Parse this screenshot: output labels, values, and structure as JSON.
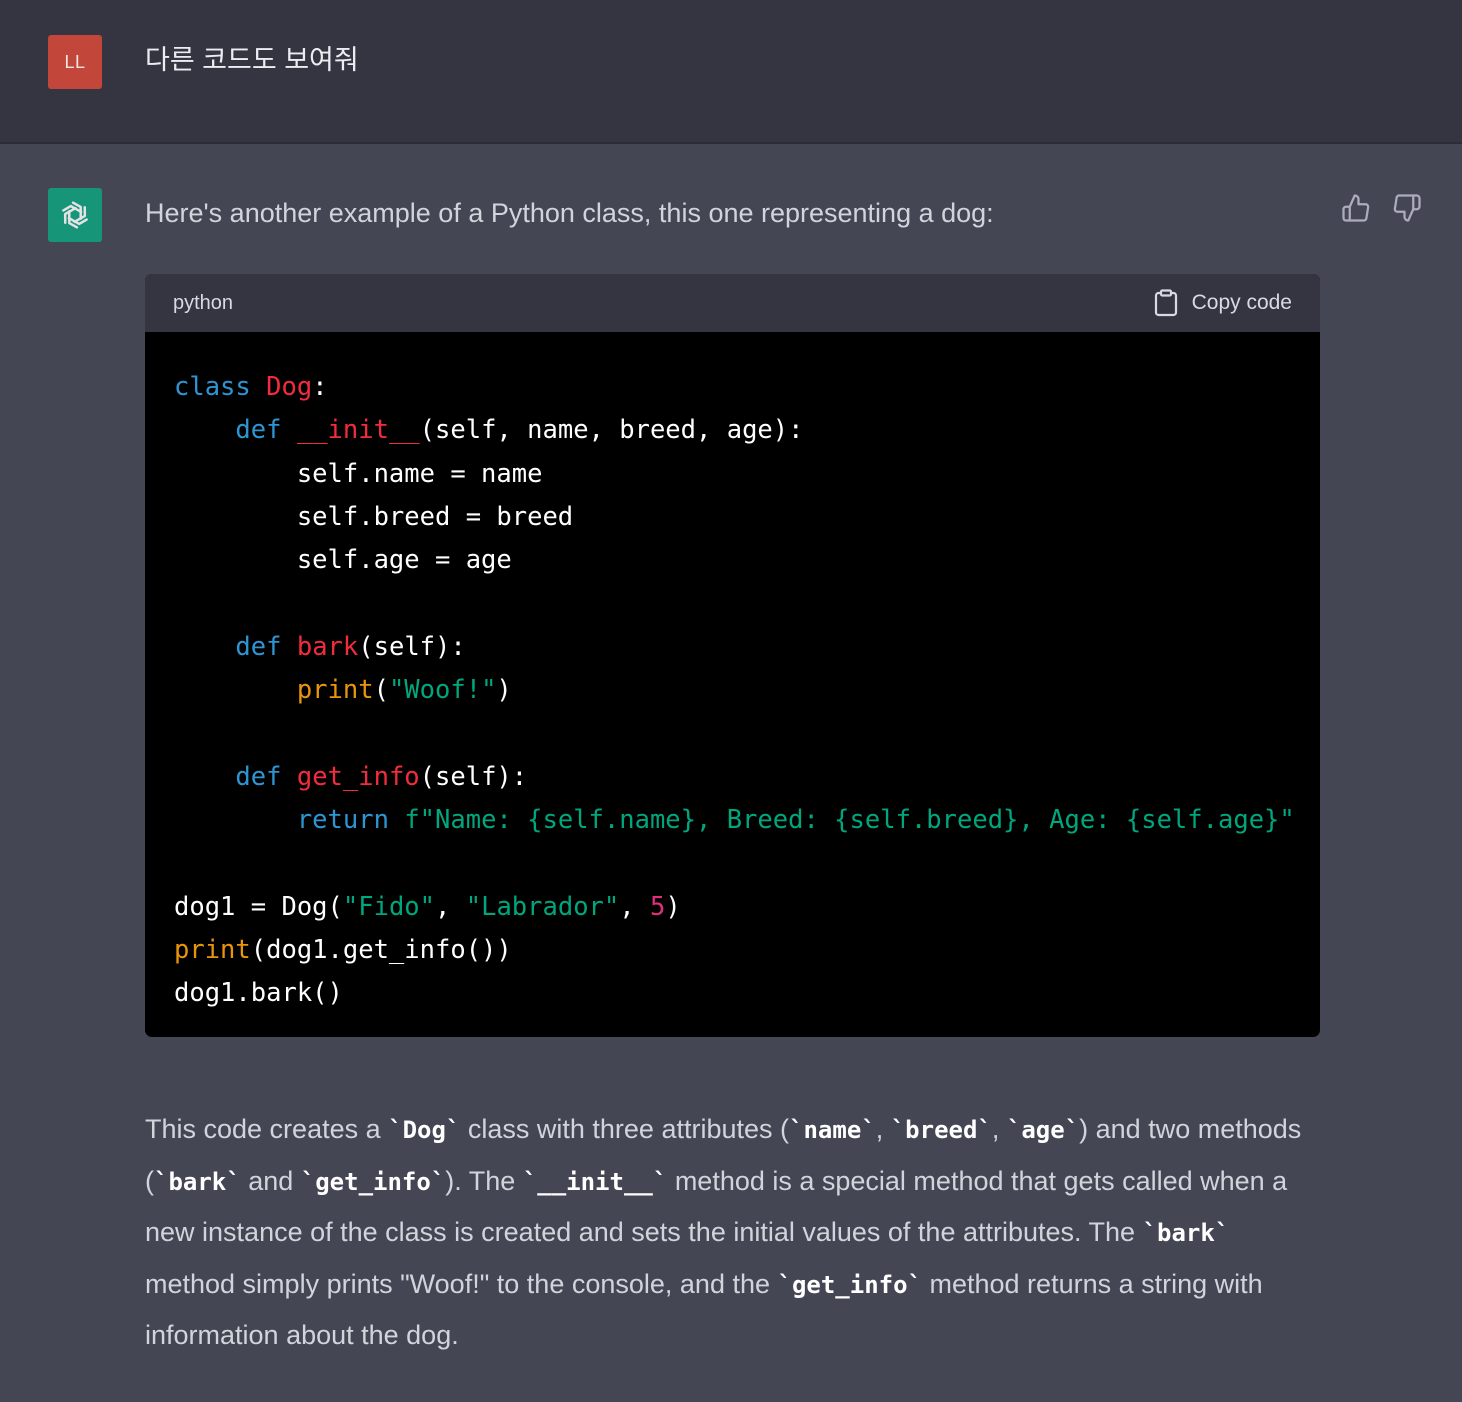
{
  "user": {
    "avatar_initials": "LL",
    "message": "다른 코드도 보여줘"
  },
  "assistant": {
    "intro": "Here's another example of a Python class, this one representing a dog:",
    "feedback": {
      "thumbs_up_icon": "thumbs-up-icon",
      "thumbs_down_icon": "thumbs-down-icon"
    },
    "code_block": {
      "language": "python",
      "copy_label": "Copy code",
      "lines": [
        [
          {
            "t": "class",
            "c": "kw"
          },
          {
            "t": " "
          },
          {
            "t": "Dog",
            "c": "fn"
          },
          {
            "t": ":"
          }
        ],
        [
          {
            "t": "    "
          },
          {
            "t": "def",
            "c": "kw"
          },
          {
            "t": " "
          },
          {
            "t": "__init__",
            "c": "fn"
          },
          {
            "t": "(self, name, breed, age):"
          }
        ],
        [
          {
            "t": "        self.name = name"
          }
        ],
        [
          {
            "t": "        self.breed = breed"
          }
        ],
        [
          {
            "t": "        self.age = age"
          }
        ],
        [
          {
            "t": ""
          }
        ],
        [
          {
            "t": "    "
          },
          {
            "t": "def",
            "c": "kw"
          },
          {
            "t": " "
          },
          {
            "t": "bark",
            "c": "fn"
          },
          {
            "t": "(self):"
          }
        ],
        [
          {
            "t": "        "
          },
          {
            "t": "print",
            "c": "bi"
          },
          {
            "t": "("
          },
          {
            "t": "\"Woof!\"",
            "c": "str"
          },
          {
            "t": ")"
          }
        ],
        [
          {
            "t": ""
          }
        ],
        [
          {
            "t": "    "
          },
          {
            "t": "def",
            "c": "kw"
          },
          {
            "t": " "
          },
          {
            "t": "get_info",
            "c": "fn"
          },
          {
            "t": "(self):"
          }
        ],
        [
          {
            "t": "        "
          },
          {
            "t": "return",
            "c": "kw"
          },
          {
            "t": " "
          },
          {
            "t": "f\"Name: {self.name}, Breed: {self.breed}, Age: {self.age}\"",
            "c": "str"
          }
        ],
        [
          {
            "t": ""
          }
        ],
        [
          {
            "t": "dog1 = Dog("
          },
          {
            "t": "\"Fido\"",
            "c": "str"
          },
          {
            "t": ", "
          },
          {
            "t": "\"Labrador\"",
            "c": "str"
          },
          {
            "t": ", "
          },
          {
            "t": "5",
            "c": "num"
          },
          {
            "t": ")"
          }
        ],
        [
          {
            "t": "print",
            "c": "bi"
          },
          {
            "t": "(dog1.get_info())"
          }
        ],
        [
          {
            "t": "dog1.bark()"
          }
        ]
      ]
    },
    "summary": [
      {
        "t": "This code creates a "
      },
      {
        "t": "`Dog`",
        "code": true
      },
      {
        "t": " class with three attributes ("
      },
      {
        "t": "`name`",
        "code": true
      },
      {
        "t": ", "
      },
      {
        "t": "`breed`",
        "code": true
      },
      {
        "t": ", "
      },
      {
        "t": "`age`",
        "code": true
      },
      {
        "t": ") and two methods ("
      },
      {
        "t": "`bark`",
        "code": true
      },
      {
        "t": " and "
      },
      {
        "t": "`get_info`",
        "code": true
      },
      {
        "t": "). The "
      },
      {
        "t": "`__init__`",
        "code": true
      },
      {
        "t": " method is a special method that gets called when a new instance of the class is created and sets the initial values of the attributes. The "
      },
      {
        "t": "`bark`",
        "code": true
      },
      {
        "t": " method simply prints \"Woof!\" to the console, and the "
      },
      {
        "t": "`get_info`",
        "code": true
      },
      {
        "t": " method returns a string with information about the dog."
      }
    ]
  },
  "colors": {
    "page_bg": "#444654",
    "user_row_bg": "#343541",
    "user_avatar": "#c2473a",
    "bot_avatar": "#10a37f",
    "code_bg": "#000000",
    "keyword": "#2e95d3",
    "function_name": "#f22c3d",
    "builtin": "#e9950c",
    "string": "#00a67d",
    "number": "#df3079"
  }
}
